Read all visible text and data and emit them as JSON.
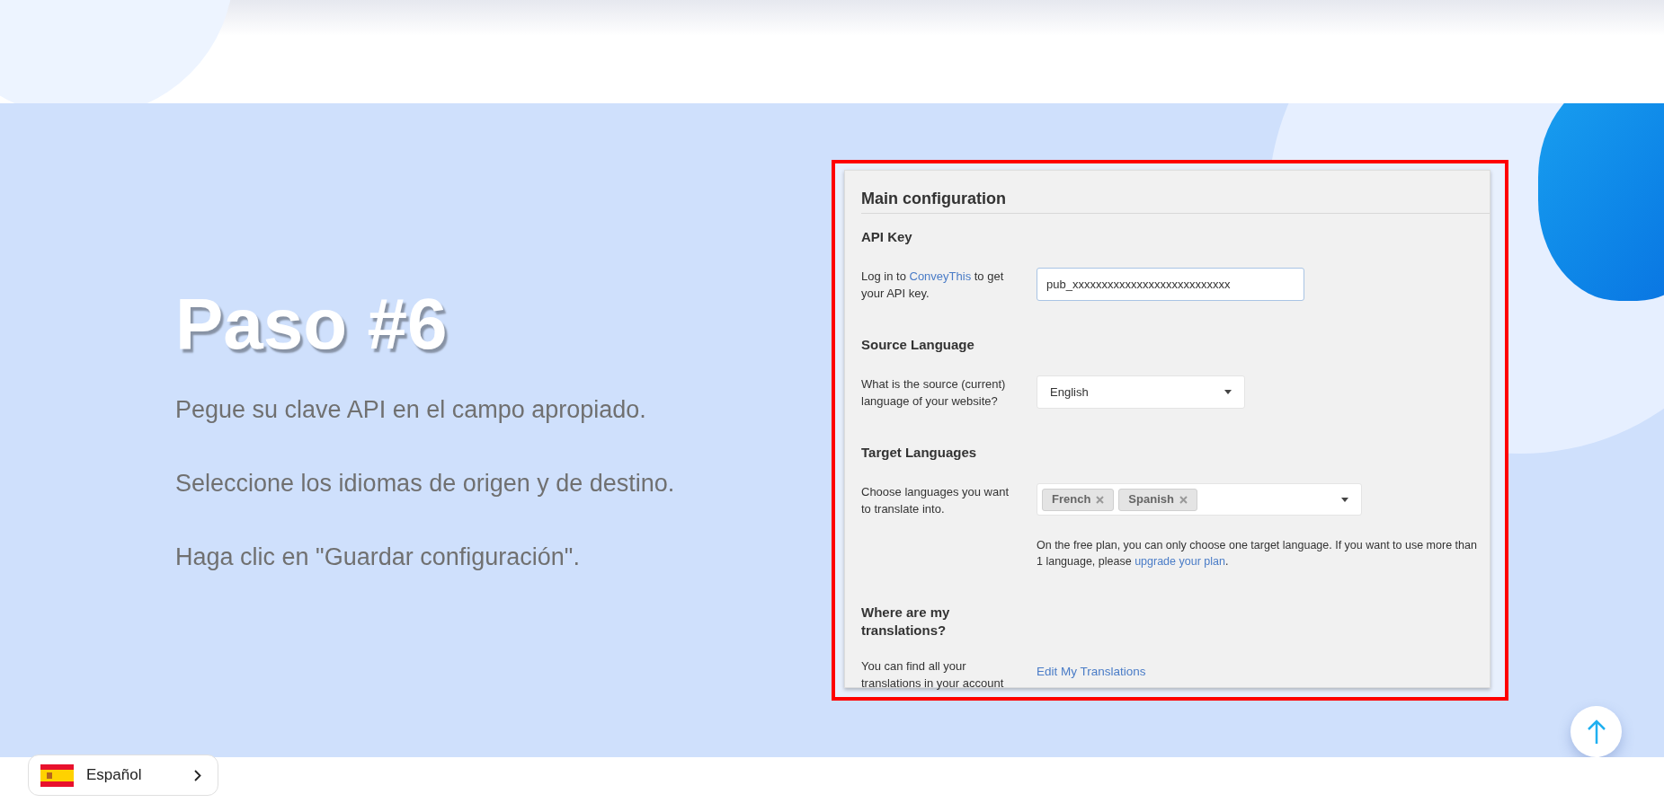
{
  "hero": {
    "title": "Paso #6",
    "paragraphs": [
      "Pegue su clave API en el campo apropiado.",
      "Seleccione los idiomas de origen y de destino.",
      "Haga clic en \"Guardar configuración\"."
    ]
  },
  "config_screenshot": {
    "title": "Main configuration",
    "sections": [
      {
        "kind": "text_input",
        "heading": "API Key",
        "description": {
          "before": "Log in to ",
          "link": "ConveyThis",
          "after": " to get your API key."
        },
        "value": "pub_xxxxxxxxxxxxxxxxxxxxxxxxxxx"
      },
      {
        "kind": "select",
        "heading": "Source Language",
        "description": {
          "before": "What is the source (current) language of your website?"
        },
        "value": "English"
      },
      {
        "kind": "multi_select",
        "heading": "Target Languages",
        "description": {
          "before": "Choose languages you want to translate into."
        },
        "tags": [
          "French",
          "Spanish"
        ],
        "note": {
          "before": "On the free plan, you can only choose one target language. If you want to use more than 1 language, please ",
          "link": "upgrade your plan",
          "after": "."
        }
      },
      {
        "kind": "link",
        "heading": "Where are my translations?",
        "description": {
          "before": "You can find all your translations in your account"
        },
        "link": "Edit My Translations"
      }
    ]
  },
  "language_selector": {
    "label": "Español"
  }
}
